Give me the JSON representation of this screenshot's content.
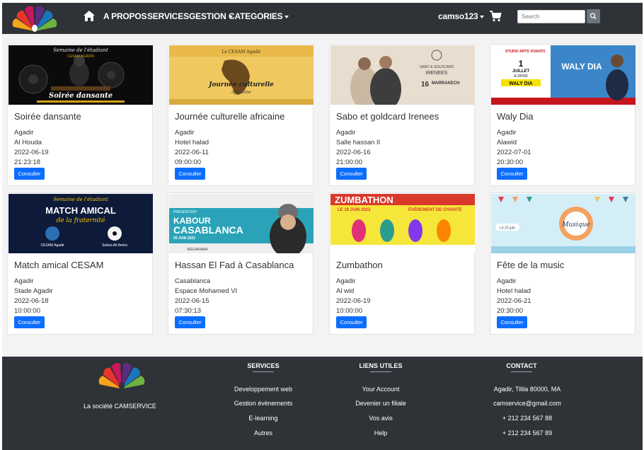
{
  "nav": {
    "links": [
      {
        "label": "A PROPOS"
      },
      {
        "label": "SERVICES"
      },
      {
        "label": "GESTION"
      },
      {
        "label": "CATEGORIES"
      }
    ],
    "user": "camso123",
    "search_placeholder": "Search"
  },
  "events": [
    {
      "title": "Soirée dansante",
      "city": "Agadir",
      "venue": "Al Houda",
      "date": "2022-06-19",
      "time": "21:23:18",
      "button": "Consulter"
    },
    {
      "title": "Journée culturelle africaine",
      "city": "Agadir",
      "venue": "Hotel halad",
      "date": "2022-06-11",
      "time": "09:00:00",
      "button": "Consulter"
    },
    {
      "title": "Sabo et goldcard Irenees",
      "city": "Agadir",
      "venue": "Salle hassan II",
      "date": "2022-06-16",
      "time": "21:00:00",
      "button": "Consulter"
    },
    {
      "title": "Waly Dia",
      "city": "Agadir",
      "venue": "Alawid",
      "date": "2022-07-01",
      "time": "20:30:00",
      "button": "Consulter"
    },
    {
      "title": "Match amical CESAM",
      "city": "Agadir",
      "venue": "Stade Agadir",
      "date": "2022-06-18",
      "time": "10:00:00",
      "button": "Consulter"
    },
    {
      "title": "Hassan El Fad à Casablanca",
      "city": "Casablanca",
      "venue": "Espace Mohamed VI",
      "date": "2022-06-15",
      "time": "07:30:13",
      "button": "Consulter"
    },
    {
      "title": "Zumbathon",
      "city": "Agadir",
      "venue": "Al wid",
      "date": "2022-06-19",
      "time": "10:00:00",
      "button": "Consulter"
    },
    {
      "title": "Fête de la music",
      "city": "Agadir",
      "venue": "Hotel halad",
      "date": "2022-06-21",
      "time": "20:30:00",
      "button": "Consulter"
    }
  ],
  "posters": {
    "p1": {
      "top": "Semaine de l'étudiant",
      "sub": "CESAM AGADIR",
      "main": "Soirée dansante"
    },
    "p2": {
      "top": "Le CESAM Agadir",
      "main": "Journée culturelle",
      "sub": "Africaine"
    },
    "p3": {
      "main": "SABO & GOLDCARD",
      "sub": "IRENEES",
      "date": "16",
      "city": "MARRAKECH"
    },
    "p4": {
      "brand": "STUDIO ARTS VIVANTS",
      "day": "1",
      "month": "JUILLET",
      "time": "A 20H30",
      "name": "WALY DIA",
      "big": "WALY DIA"
    },
    "p5": {
      "top": "Semaine de l'étudiant",
      "main": "MATCH AMICAL",
      "sub": "de la fraternité",
      "left": "CESAM Agadir",
      "right": "Subea Ait Amira"
    },
    "p6": {
      "top": "PRESENTENT",
      "main1": "KABOUR",
      "main2": "CASABLANCA",
      "date": "09 JUIN 2022",
      "venue": "MEGARAMA"
    },
    "p7": {
      "main": "ZUMBATHON",
      "date": "LE 19 JUIN 2022",
      "sub": "ÉVÉNEMENT DE CHARITÉ"
    },
    "p8": {
      "main": "Musique",
      "tag": "Le 21 juin"
    }
  },
  "footer": {
    "company": "La société CAMSERVICE",
    "columns": [
      {
        "heading": "SERVICES",
        "items": [
          "Developpement web",
          "Gestion évènements",
          "E-learning",
          "Autres"
        ]
      },
      {
        "heading": "LIENS UTILES",
        "items": [
          "Your Account",
          "Devenier un filiale",
          "Vos avis",
          "Help"
        ]
      },
      {
        "heading": "CONTACT",
        "items": [
          "Agadir, Tilila 80000, MA",
          "camservice@gmail.com",
          "+ 212 234 567 88",
          "+ 212 234 567 89"
        ]
      }
    ]
  },
  "colors": {
    "navbar": "#2f3237",
    "footer": "#2f3237",
    "primary_button": "#0d6efd",
    "background": "#f3f3f3"
  },
  "icons": [
    "brand-logo",
    "home-icon",
    "cart-icon",
    "search-icon"
  ]
}
